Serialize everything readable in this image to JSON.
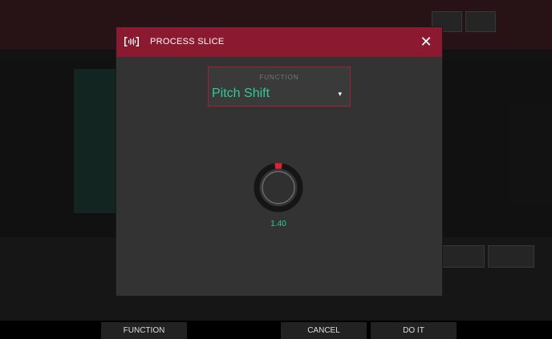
{
  "dialog": {
    "title": "PROCESS SLICE",
    "logo_icon": "waveform-icon",
    "close_icon": "close-icon",
    "close_glyph": "✕",
    "function_label": "FUNCTION",
    "function_value": "Pitch Shift",
    "caret_glyph": "▾",
    "knob_value": "1.40",
    "knob_level": 0.05
  },
  "softkeys": {
    "function": "FUNCTION",
    "cancel": "CANCEL",
    "do_it": "DO IT"
  },
  "colors": {
    "accent": "#8b1a30",
    "value_text": "#2ecc9a",
    "knob_indicator": "#e0203a"
  }
}
